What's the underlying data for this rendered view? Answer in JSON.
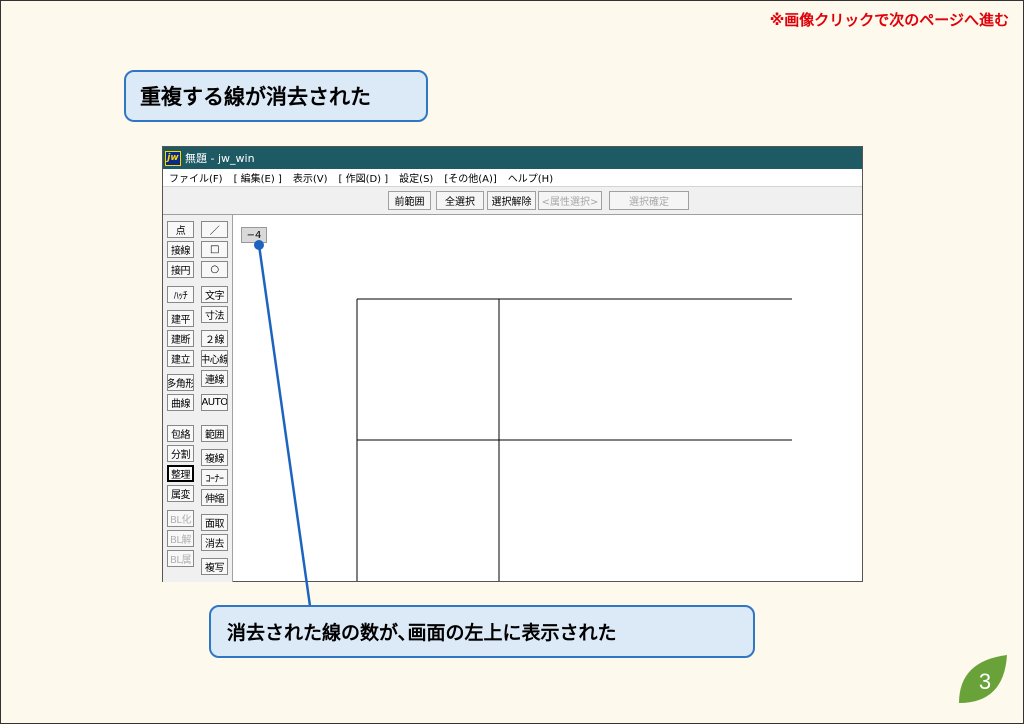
{
  "slide": {
    "top_note": "※画像クリックで次のページへ進む",
    "callout_top": "重複する線が消去された",
    "callout_bottom": "消去された線の数が､画面の左上に表示された",
    "page_number": "3"
  },
  "window": {
    "title": "無題 - jw_win",
    "app_icon": "jw",
    "menu": [
      "ファイル(F)",
      "[ 編集(E) ]",
      "表示(V)",
      "[ 作図(D) ]",
      "設定(S)",
      "[その他(A)]",
      "ヘルプ(H)"
    ],
    "toolbar": {
      "prev_range": "前範囲",
      "select_all": "全選択",
      "deselect": "選択解除",
      "attr_select": "<属性選択>",
      "confirm": "選択確定"
    },
    "left_col1": [
      "点",
      "接線",
      "接円",
      "ﾊｯﾁ",
      "建平",
      "建断",
      "建立",
      "多角形",
      "曲線",
      "包絡",
      "分割",
      "整理",
      "属変",
      "BL化",
      "BL解",
      "BL属"
    ],
    "left_col2": [
      "／",
      "□",
      "○",
      "文字",
      "寸法",
      "２線",
      "中心線",
      "連線",
      "AUTO",
      "範囲",
      "複線",
      "ｺｰﾅｰ",
      "伸縮",
      "面取",
      "消去",
      "複写"
    ],
    "counter": "−4"
  },
  "colors": {
    "titlebar": "#1e5a64",
    "callout_bg": "#dceaf8",
    "callout_border": "#2f76c5",
    "note": "#e0000a",
    "badge": "#6aa23a",
    "pointer_line": "#1c64c0"
  }
}
